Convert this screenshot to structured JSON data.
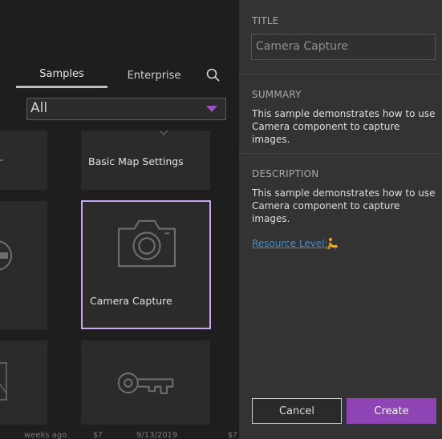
{
  "tabs": {
    "samples": "Samples",
    "enterprise": "Enterprise"
  },
  "filter": {
    "value": "All"
  },
  "cards": {
    "basic_map_settings": "Basic Map Settings",
    "camera_capture": "Camera Capture"
  },
  "footer": {
    "a": "weeks ago",
    "b": "$?",
    "c": "9/13/2019",
    "d": "$?"
  },
  "details": {
    "title_label": "TITLE",
    "title_value": "Camera Capture",
    "summary_label": "SUMMARY",
    "summary_text": "This sample demonstrates how to use Camera component to capture images.",
    "description_label": "DESCRIPTION",
    "description_text": "This sample demonstrates how to use Camera component to capture images.",
    "resource_level": "Resource Level:",
    "cancel": "Cancel",
    "create": "Create"
  },
  "colors": {
    "accent": "#8e44b5",
    "selected_border": "#c9a6f0",
    "link": "#3b8fd6"
  }
}
